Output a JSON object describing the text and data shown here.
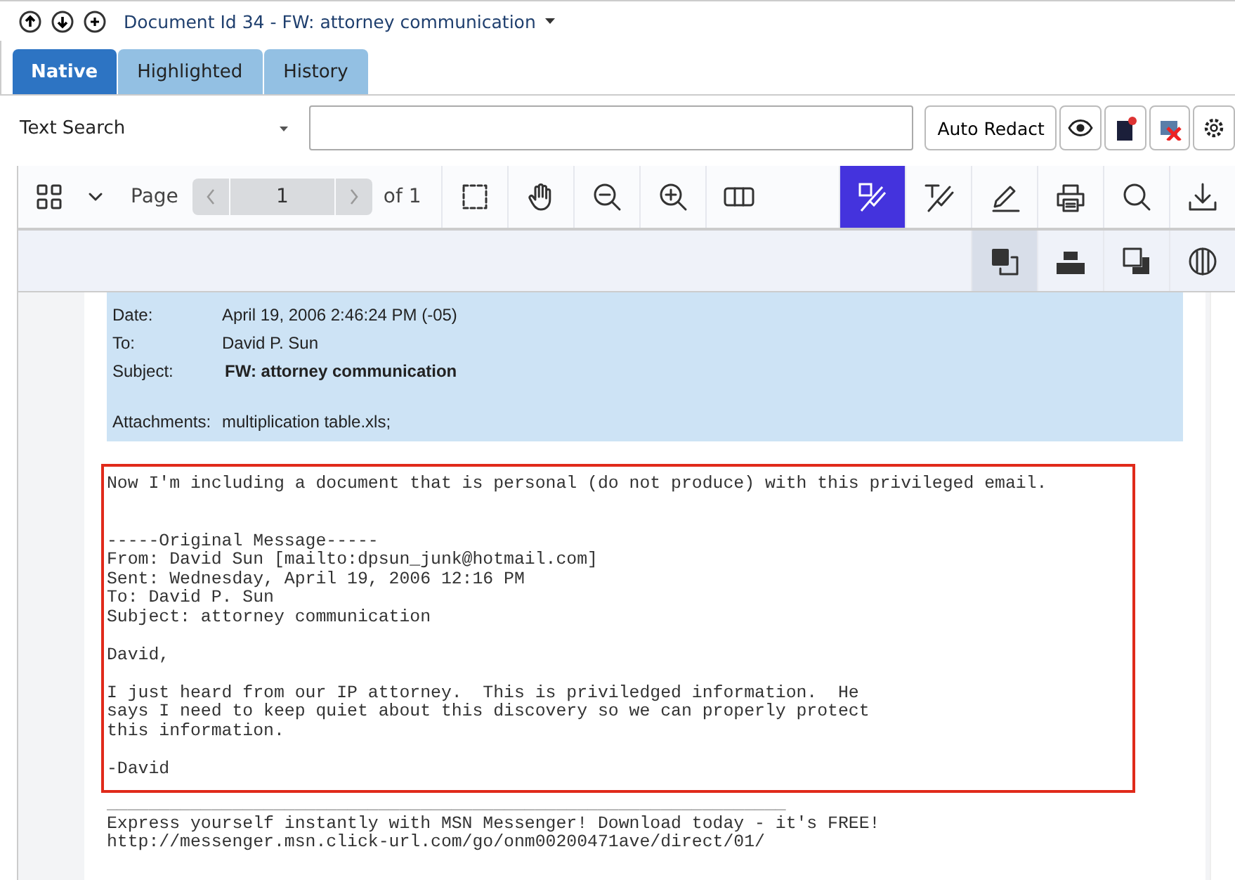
{
  "header": {
    "title": "Document Id 34 - FW: attorney communication"
  },
  "tabs": [
    {
      "label": "Native",
      "selected": true
    },
    {
      "label": "Highlighted",
      "selected": false
    },
    {
      "label": "History",
      "selected": false
    }
  ],
  "search": {
    "mode": "Text Search",
    "auto_redact": "Auto Redact"
  },
  "toolbar": {
    "page_label": "Page",
    "page": "1",
    "of": "of 1",
    "tools": [
      {
        "kind": "marquee",
        "selected": false
      },
      {
        "kind": "hand",
        "selected": false
      },
      {
        "kind": "zoom-out",
        "selected": false
      },
      {
        "kind": "zoom-in",
        "selected": false
      },
      {
        "kind": "columns",
        "selected": false
      },
      {
        "kind": "redact-area",
        "selected": true
      },
      {
        "kind": "redact-text",
        "selected": false
      },
      {
        "kind": "pencil",
        "selected": false
      },
      {
        "kind": "print",
        "selected": false
      },
      {
        "kind": "search",
        "selected": false
      },
      {
        "kind": "download",
        "selected": false
      }
    ],
    "subtools": [
      {
        "kind": "overlay",
        "selected": true
      },
      {
        "kind": "text-bar",
        "selected": false
      },
      {
        "kind": "shadow",
        "selected": false
      },
      {
        "kind": "contrast",
        "selected": false
      }
    ]
  },
  "email": {
    "fields": [
      {
        "label": "Date:",
        "value": "April 19, 2006 2:46:24 PM (-05)",
        "bold": false
      },
      {
        "label": "To:",
        "value": "David P. Sun",
        "bold": false
      },
      {
        "label": "Subject:",
        "value": "FW: attorney communication",
        "bold": true
      },
      {
        "label": "Attachments:",
        "value": "multiplication table.xls;",
        "bold": false
      }
    ],
    "body": [
      "Now I'm including a document that is personal (do not produce) with this privileged email.",
      "-----Original Message-----\nFrom: David Sun [mailto:dpsun_junk@hotmail.com]\nSent: Wednesday, April 19, 2006 12:16 PM\nTo: David P. Sun\nSubject: attorney communication",
      "David,",
      "I just heard from our IP attorney.  This is priviledged information.  He\nsays I need to keep quiet about this discovery so we can properly protect\nthis information.",
      "-David"
    ],
    "footer": [
      "_________________________________________________________________",
      "Express yourself instantly with MSN Messenger! Download today - it's FREE!",
      "http://messenger.msn.click-url.com/go/onm00200471ave/direct/01/"
    ]
  }
}
